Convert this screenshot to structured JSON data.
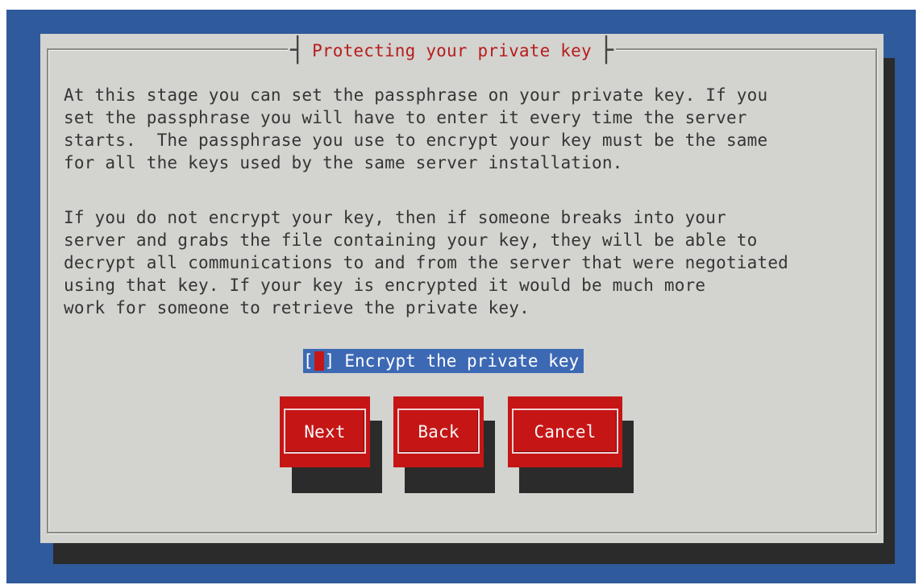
{
  "dialog": {
    "title": "Protecting your private key",
    "paragraph_1": [
      "At this stage you can set the passphrase on your private key. If you",
      "set the passphrase you will have to enter it every time the server",
      "starts.  The passphrase you use to encrypt your key must be the same",
      "for all the keys used by the same server installation."
    ],
    "paragraph_2": [
      "If you do not encrypt your key, then if someone breaks into your",
      "server and grabs the file containing your key, they will be able to",
      "decrypt all communications to and from the server that were negotiated",
      "using that key. If your key is encrypted it would be much more",
      "work for someone to retrieve the private key."
    ],
    "checkbox": {
      "label": "Encrypt the private key",
      "left_bracket": "[",
      "right_bracket": "]",
      "checked": false
    },
    "buttons": {
      "next": "Next",
      "back": "Back",
      "cancel": "Cancel"
    }
  },
  "colors": {
    "desktop": "#2f5a9b",
    "dialog": "#d3d3cf",
    "title": "#b71d1d",
    "button": "#c61515",
    "selection": "#3d69b4"
  }
}
